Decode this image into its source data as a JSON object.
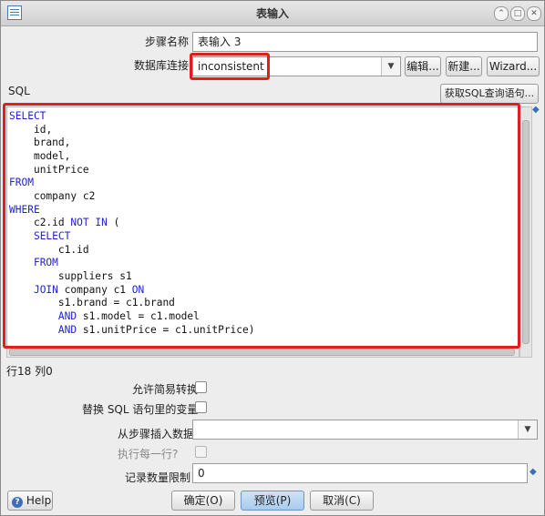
{
  "window": {
    "title": "表输入"
  },
  "form": {
    "step_name_label": "步骤名称",
    "step_name_value": "表输入 3",
    "db_conn_label": "数据库连接",
    "db_conn_value": "inconsistent",
    "edit_btn": "编辑...",
    "new_btn": "新建...",
    "wizard_btn": "Wizard...",
    "sql_label": "SQL",
    "get_sql_btn": "获取SQL查询语句...",
    "cursor_pos": "行18 列0",
    "lazy_label": "允许简易转换",
    "replace_vars_label": "替换 SQL 语句里的变量",
    "insert_from_label": "从步骤插入数据",
    "insert_from_value": "",
    "exec_each_label": "执行每一行?",
    "limit_label": "记录数量限制",
    "limit_value": "0"
  },
  "sql_lines": [
    "SELECT",
    "    id,",
    "    brand,",
    "    model,",
    "    unitPrice",
    "FROM",
    "    company c2",
    "WHERE",
    "    c2.id NOT IN (",
    "    SELECT",
    "        c1.id",
    "    FROM",
    "        suppliers s1",
    "    JOIN company c1 ON",
    "        s1.brand = c1.brand",
    "        AND s1.model = c1.model",
    "        AND s1.unitPrice = c1.unitPrice)"
  ],
  "buttons": {
    "help": "Help",
    "ok": "确定(O)",
    "preview": "预览(P)",
    "cancel": "取消(C)"
  },
  "colors": {
    "keyword": "#1f1fd6",
    "highlight": "#e01e1e"
  }
}
